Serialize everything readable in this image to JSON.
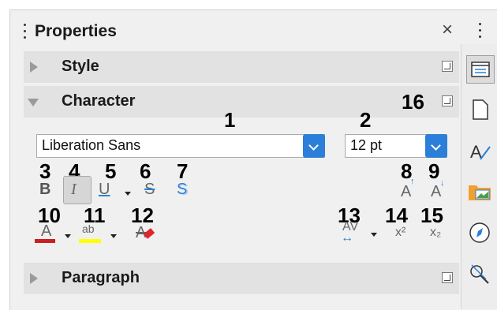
{
  "panel": {
    "title": "Properties",
    "close_glyph": "×"
  },
  "sections": {
    "style": {
      "label": "Style"
    },
    "character": {
      "label": "Character"
    },
    "paragraph": {
      "label": "Paragraph"
    }
  },
  "character": {
    "font_name": {
      "value": "Liberation Sans"
    },
    "font_size": {
      "value": "12 pt"
    }
  },
  "callouts": {
    "n1": "1",
    "n2": "2",
    "n3": "3",
    "n4": "4",
    "n5": "5",
    "n6": "6",
    "n7": "7",
    "n8": "8",
    "n9": "9",
    "n10": "10",
    "n11": "11",
    "n12": "12",
    "n13": "13",
    "n14": "14",
    "n15": "15",
    "n16": "16"
  },
  "tools": {
    "bold": "B",
    "italic": "I",
    "underline": "U",
    "strikethrough": "S",
    "shadow": "S",
    "grow": "A",
    "shrink": "A",
    "font_color": "A",
    "highlight": "ab",
    "clear": "A",
    "spacing": "AV",
    "superscript": "x²",
    "subscript": "x₂"
  },
  "icons": {
    "grip": "drag-handle-icon",
    "more": "more-options-icon",
    "sidebar": [
      "properties-icon",
      "page-icon",
      "styles-icon",
      "gallery-icon",
      "navigator-icon",
      "inspector-icon"
    ]
  },
  "colors": {
    "accent": "#2b7fd8",
    "font_color_bar": "#cc1f1f",
    "highlight_bar": "#ffff00",
    "section_bg": "#e2e2e2"
  }
}
